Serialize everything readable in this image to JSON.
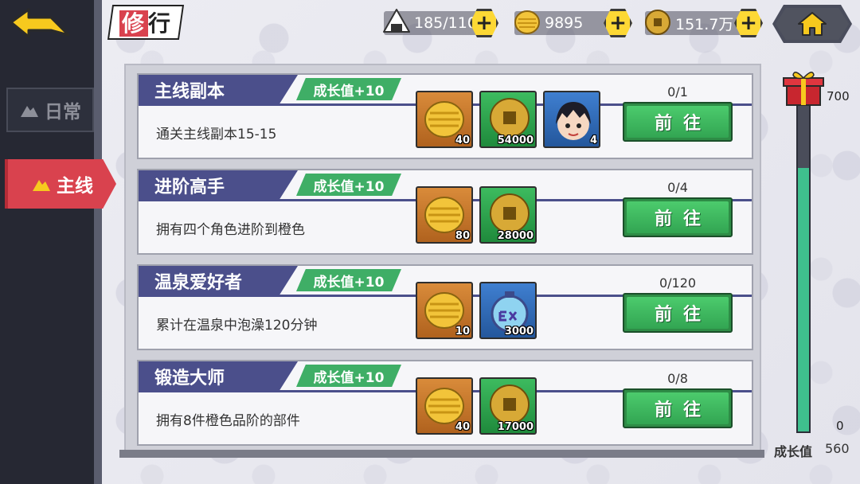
{
  "header": {
    "title_char1": "修",
    "title_char2": "行",
    "resources": [
      {
        "name": "stamina",
        "value": "185/110",
        "icon": "rice-ball-icon"
      },
      {
        "name": "gold",
        "value": "9895",
        "icon": "gold-ingot-icon"
      },
      {
        "name": "coin",
        "value": "151.7万",
        "icon": "copper-coin-icon"
      }
    ],
    "home_icon": "home-icon",
    "back_icon": "back-arrow-icon"
  },
  "sidebar": {
    "tabs": [
      {
        "label": "日常",
        "active": false
      },
      {
        "label": "主线",
        "active": true
      }
    ]
  },
  "tasks": [
    {
      "title": "主线副本",
      "growth": "成长值+10",
      "desc": "通关主线副本15-15",
      "progress": "0/1",
      "button": "前往",
      "rewards": [
        {
          "type": "gold-ingot",
          "count": "40"
        },
        {
          "type": "copper-coin",
          "count": "54000"
        },
        {
          "type": "character-portrait",
          "count": "4"
        }
      ]
    },
    {
      "title": "进阶高手",
      "growth": "成长值+10",
      "desc": "拥有四个角色进阶到橙色",
      "progress": "0/4",
      "button": "前往",
      "rewards": [
        {
          "type": "gold-ingot",
          "count": "80"
        },
        {
          "type": "copper-coin",
          "count": "28000"
        }
      ]
    },
    {
      "title": "温泉爱好者",
      "growth": "成长值+10",
      "desc": "累计在温泉中泡澡120分钟",
      "progress": "0/120",
      "button": "前往",
      "rewards": [
        {
          "type": "gold-ingot",
          "count": "10"
        },
        {
          "type": "exp-potion",
          "count": "3000"
        }
      ]
    },
    {
      "title": "锻造大师",
      "growth": "成长值+10",
      "desc": "拥有8件橙色品阶的部件",
      "progress": "0/8",
      "button": "前往",
      "rewards": [
        {
          "type": "gold-ingot",
          "count": "40"
        },
        {
          "type": "copper-coin",
          "count": "17000"
        }
      ]
    }
  ],
  "gauge": {
    "max_label": "700",
    "min_label": "0",
    "label": "成长值",
    "value": "560",
    "fill_fraction": 0.8,
    "icon": "gift-box-icon",
    "fill_color": "#3fbf8e"
  },
  "colors": {
    "accent_red": "#d9424e",
    "task_header": "#4b4f8b",
    "growth_green": "#3fae66",
    "button_green": "#32a552"
  }
}
